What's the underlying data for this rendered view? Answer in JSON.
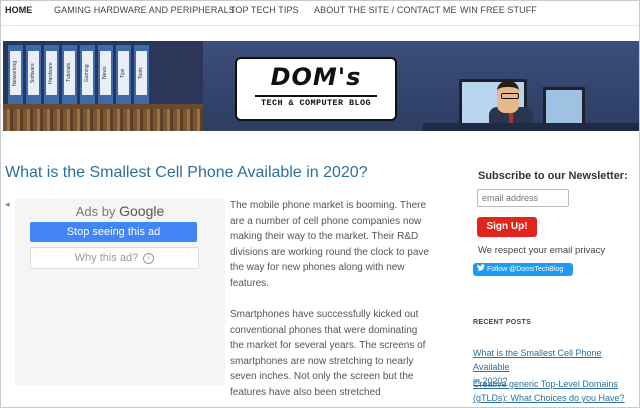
{
  "nav": {
    "items": [
      {
        "label": "HOME"
      },
      {
        "label": "GAMING HARDWARE AND PERIPHERALS"
      },
      {
        "label": "TOP TECH TIPS"
      },
      {
        "label": "ABOUT THE SITE / CONTACT ME"
      },
      {
        "label": "WIN FREE STUFF"
      }
    ]
  },
  "banner": {
    "logo_title": "DOM's",
    "logo_subtitle": "TECH & COMPUTER BLOG",
    "binders": [
      "Networking",
      "Software",
      "Hardware",
      "Tutorials",
      "Gaming",
      "News",
      "Tips",
      "Tools"
    ]
  },
  "article": {
    "title": "What is the Smallest Cell Phone Available in 2020?",
    "paragraphs": [
      "The mobile phone market is booming. There are a number of cell phone companies now making their way to the market. Their R&D divisions are working round the clock to pave the way for new phones along with new features.",
      "Smartphones have successfully kicked out conventional phones that were dominating the market for several years. The screens of smartphones are now stretching to nearly seven inches. Not only the screen but the features have also been stretched"
    ]
  },
  "ad": {
    "ads_by": "Ads by",
    "brand": "Google",
    "stop_label": "Stop seeing this ad",
    "why_label": "Why this ad?",
    "info_glyph": "i",
    "back_glyph": "◂"
  },
  "sidebar": {
    "newsletter_title": "Subscribe to our Newsletter:",
    "email_placeholder": "email address",
    "signup_label": "Sign Up!",
    "privacy_text": "We respect your email privacy",
    "twitter_label": "Follow @DomsTechBlog",
    "twitter_icon": "twitter-bird-icon",
    "recent_heading": "RECENT POSTS",
    "recent_posts": [
      {
        "line1": "What is the Smallest Cell Phone Available",
        "line2": "in 2020?"
      },
      {
        "line1": "Creative generic Top-Level Domains",
        "line2": "(gTLDs): What Choices do you Have?"
      }
    ]
  },
  "colors": {
    "link": "#2b6f9e",
    "ad_button": "#4285f4",
    "signup": "#e3241d",
    "twitter": "#1d9bf0"
  }
}
